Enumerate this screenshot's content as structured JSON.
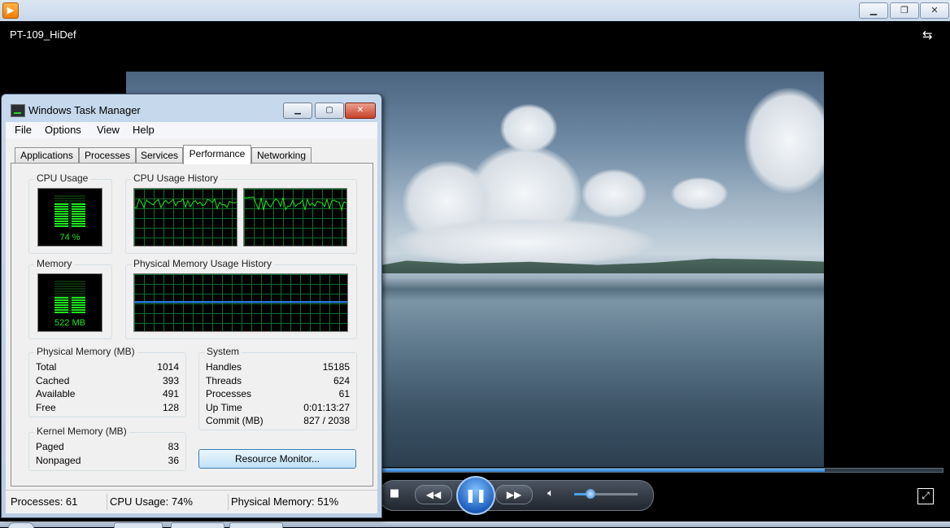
{
  "player": {
    "title": "PT-109_HiDef",
    "app_icon": "media-player-icon",
    "seek_progress": 0.79,
    "volume_level": 0.26,
    "controls": {
      "stop_icon": "stop-icon",
      "prev_icon": "rewind-icon",
      "play_icon": "pause-icon",
      "next_icon": "fast-forward-icon",
      "mute_icon": "speaker-icon",
      "fullscreen_icon": "fullscreen-icon",
      "switch_icon": "switch-to-library-icon"
    }
  },
  "taskmgr": {
    "title": "Windows Task Manager",
    "menu": [
      "File",
      "Options",
      "View",
      "Help"
    ],
    "tabs": [
      "Applications",
      "Processes",
      "Services",
      "Performance",
      "Networking"
    ],
    "active_tab": "Performance",
    "groups": {
      "cpu_usage": "CPU Usage",
      "cpu_history": "CPU Usage History",
      "memory": "Memory",
      "mem_history": "Physical Memory Usage History",
      "physical_memory": "Physical Memory (MB)",
      "system": "System",
      "kernel_memory": "Kernel Memory (MB)"
    },
    "cpu_meter_text": "74 %",
    "mem_meter_text": "522 MB",
    "physical_memory": [
      {
        "label": "Total",
        "value": "1014"
      },
      {
        "label": "Cached",
        "value": "393"
      },
      {
        "label": "Available",
        "value": "491"
      },
      {
        "label": "Free",
        "value": "128"
      }
    ],
    "system": [
      {
        "label": "Handles",
        "value": "15185"
      },
      {
        "label": "Threads",
        "value": "624"
      },
      {
        "label": "Processes",
        "value": "61"
      },
      {
        "label": "Up Time",
        "value": "0:01:13:27"
      },
      {
        "label": "Commit (MB)",
        "value": "827 / 2038"
      }
    ],
    "kernel_memory": [
      {
        "label": "Paged",
        "value": "83"
      },
      {
        "label": "Nonpaged",
        "value": "36"
      }
    ],
    "resource_monitor_button": "Resource Monitor...",
    "status": {
      "processes": "Processes: 61",
      "cpu": "CPU Usage: 74%",
      "memory": "Physical Memory: 51%"
    },
    "colors": {
      "graph_line": "#1fe61f",
      "memory_line": "#2f8cff",
      "grid": "#0c6e2f"
    }
  }
}
